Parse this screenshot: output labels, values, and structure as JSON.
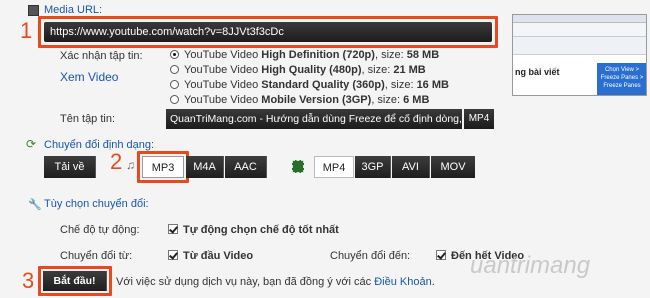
{
  "sections": {
    "media_url_title": "Media URL:",
    "convert_format_title": "Chuyển đổi định dạng:",
    "convert_options_title": "Tùy chọn chuyển đổi:"
  },
  "media_url": {
    "value": "https://www.youtube.com/watch?v=8JJVt3f3cDc"
  },
  "step_numbers": [
    "1",
    "2",
    "3"
  ],
  "quality": {
    "label": "Xác nhận tập tin:",
    "preview_link": "Xem Video",
    "options": [
      {
        "prefix": "YouTube Video ",
        "bold": "High Definition (720p)",
        "suffix": ", size: ",
        "size": "58 MB",
        "selected": true
      },
      {
        "prefix": "YouTube Video ",
        "bold": "High Quality (480p)",
        "suffix": ", size: ",
        "size": "21 MB",
        "selected": false
      },
      {
        "prefix": "YouTube Video ",
        "bold": "Standard Quality (360p)",
        "suffix": ", size: ",
        "size": "16 MB",
        "selected": false
      },
      {
        "prefix": "YouTube Video ",
        "bold": "Mobile Version (3GP)",
        "suffix": ", size: ",
        "size": "6 MB",
        "selected": false
      }
    ]
  },
  "filename": {
    "label": "Tên tập tin:",
    "value": "QuanTriMang.com - Hướng dẫn dùng Freeze để cố định dòng, cột dễ",
    "ext": "MP4"
  },
  "formats": {
    "download_label": "Tải về",
    "audio": [
      "MP3",
      "M4A",
      "AAC"
    ],
    "video": [
      "MP4",
      "3GP",
      "AVI",
      "MOV"
    ],
    "selected_audio": "MP3",
    "selected_video": "MP4"
  },
  "options": {
    "auto_quality_label": "Chế độ tự động:",
    "auto_quality_value": "Tự động chọn chế độ tốt nhất",
    "from_label": "Chuyển đổi từ:",
    "from_value": "Từ đầu Video",
    "to_label": "Chuyển đổi đến:",
    "to_value": "Đến hết Video"
  },
  "start": {
    "button_label": "Bắt đầu!",
    "terms_text": "Với việc sử dụng dịch vụ này, bạn đã đồng ý với các",
    "terms_link": "Điều Khoản",
    "terms_end": "."
  },
  "thumbnail": {
    "tooltip_lines": [
      "Chọn View >",
      "Freeze Panes >",
      "Freeze Panes"
    ],
    "caption": "ng bài viết"
  },
  "watermark": "uantrimang",
  "colors": {
    "accent_red": "#e84a1f",
    "link_blue": "#1a56a8",
    "dark_button": "#2a2a2a"
  }
}
